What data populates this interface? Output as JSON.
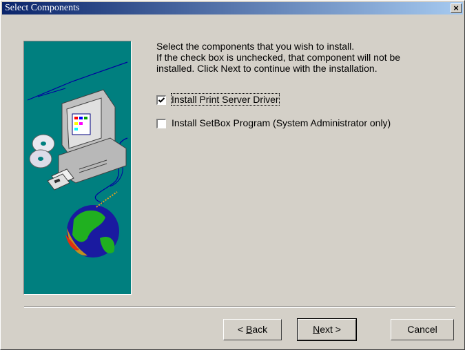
{
  "window": {
    "title": "Select Components",
    "close_glyph": "×"
  },
  "description": {
    "lines": [
      "Select the components that you wish to install.",
      "If the check box is unchecked, that component will not be",
      "installed. Click Next to continue with the installation."
    ]
  },
  "options": [
    {
      "label": "Install Print Server Driver",
      "checked": true
    },
    {
      "label": "Install SetBox Program (System Administrator only)",
      "checked": false
    }
  ],
  "buttons": {
    "back_prefix": "< ",
    "back_mnemonic": "B",
    "back_rest": "ack",
    "next_mnemonic": "N",
    "next_rest": "ext >",
    "cancel": "Cancel"
  },
  "colors": {
    "titlebar_start": "#0a246a",
    "titlebar_end": "#a6caf0",
    "panel": "#d4d0c8",
    "art_bg": "#007f7f"
  },
  "icons": [
    "close-icon",
    "computer-icon",
    "cd-icon",
    "floppy-icon",
    "globe-icon",
    "checkmark-icon"
  ]
}
